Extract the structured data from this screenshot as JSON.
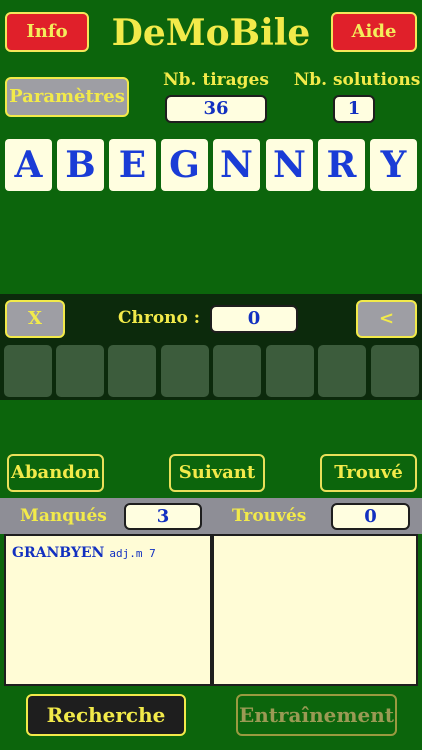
{
  "header": {
    "info_label": "Info",
    "title": "DeMoBile",
    "help_label": "Aide"
  },
  "settings": {
    "params_label": "Paramètres",
    "draws_label": "Nb. tirages",
    "draws_value": "36",
    "solutions_label": "Nb. solutions",
    "solutions_value": "1"
  },
  "tiles": [
    "A",
    "B",
    "E",
    "G",
    "N",
    "N",
    "R",
    "Y"
  ],
  "chrono": {
    "clear_label": "X",
    "label": "Chrono :",
    "value": "0",
    "back_label": "<"
  },
  "actions": {
    "abandon_label": "Abandon",
    "next_label": "Suivant",
    "found_label": "Trouvé"
  },
  "results": {
    "missed_label": "Manqués",
    "missed_count": "3",
    "found_label": "Trouvés",
    "found_count": "0",
    "missed_words": [
      {
        "word": "GRANBYEN",
        "info": "adj.m 7"
      }
    ]
  },
  "bottom": {
    "search_label": "Recherche",
    "training_label": "Entraînement"
  },
  "colors": {
    "background": "#0c650c",
    "accent_yellow": "#f2ea4a",
    "button_red": "#e0202a",
    "tile_text": "#1a3cd6"
  }
}
